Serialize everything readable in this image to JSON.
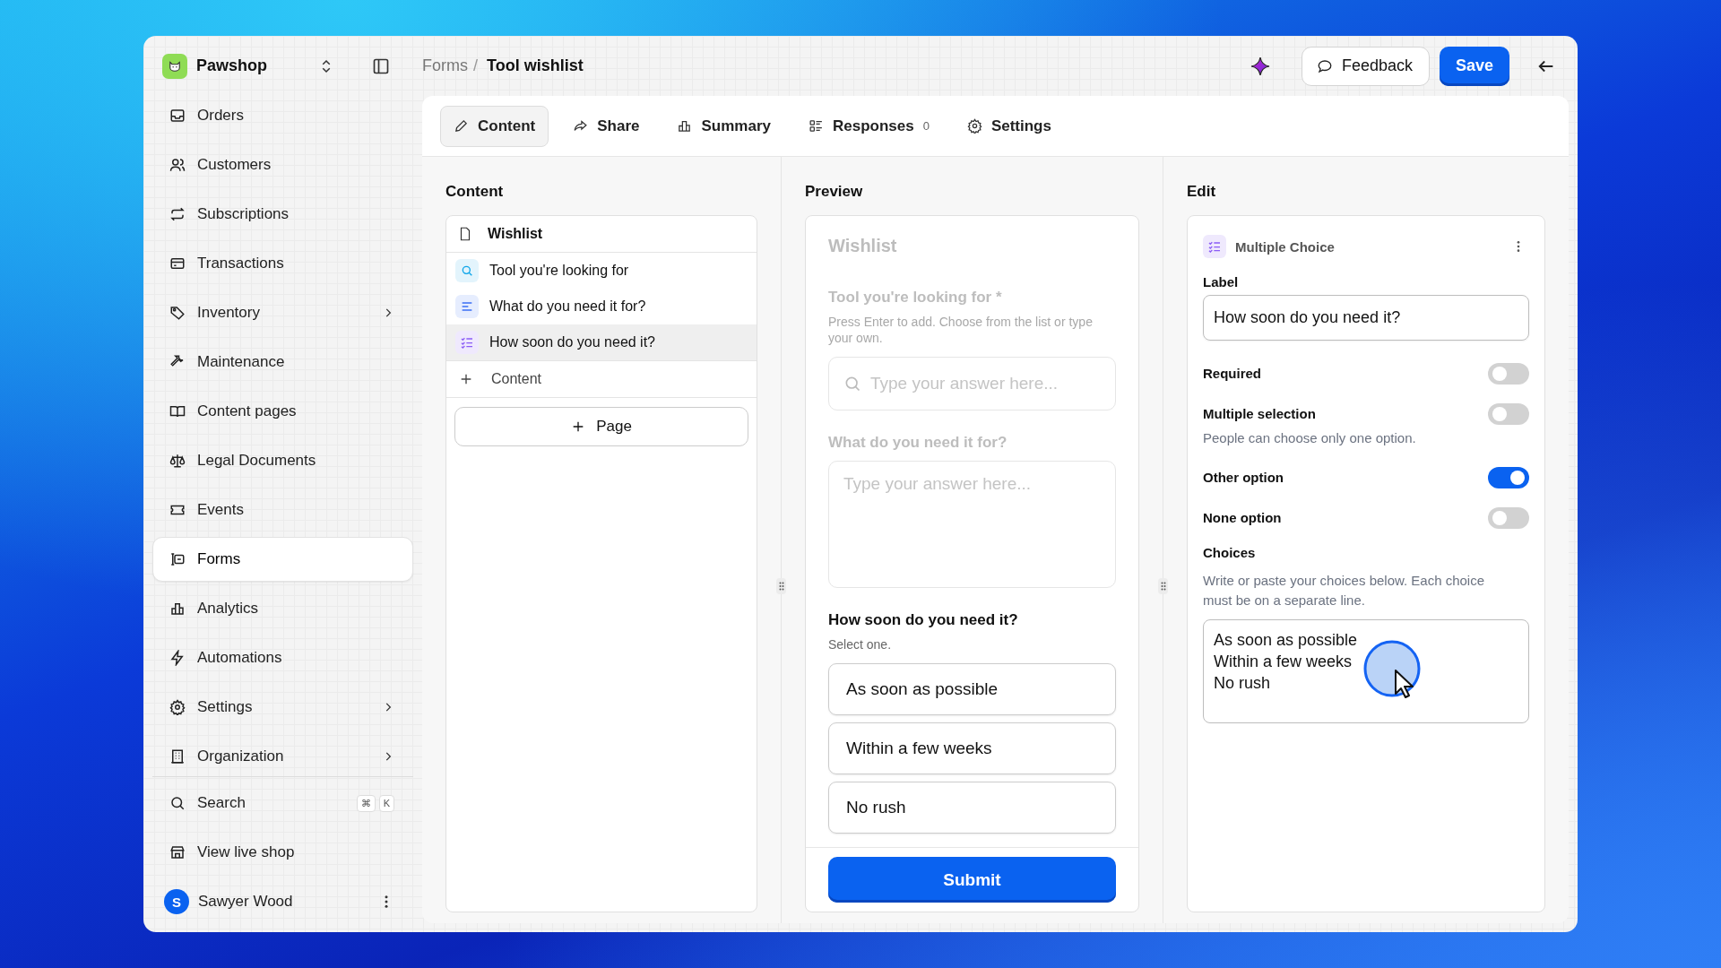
{
  "app": {
    "name": "Pawshop"
  },
  "sidebar": {
    "items": [
      {
        "label": "Orders",
        "selected": false,
        "submenu": false
      },
      {
        "label": "Customers",
        "selected": false,
        "submenu": false
      },
      {
        "label": "Subscriptions",
        "selected": false,
        "submenu": false
      },
      {
        "label": "Transactions",
        "selected": false,
        "submenu": false
      },
      {
        "label": "Inventory",
        "selected": false,
        "submenu": true
      },
      {
        "label": "Maintenance",
        "selected": false,
        "submenu": false
      },
      {
        "label": "Content pages",
        "selected": false,
        "submenu": false
      },
      {
        "label": "Legal Documents",
        "selected": false,
        "submenu": false
      },
      {
        "label": "Events",
        "selected": false,
        "submenu": false
      },
      {
        "label": "Forms",
        "selected": true,
        "submenu": false
      },
      {
        "label": "Analytics",
        "selected": false,
        "submenu": false
      },
      {
        "label": "Automations",
        "selected": false,
        "submenu": false
      },
      {
        "label": "Settings",
        "selected": false,
        "submenu": true
      },
      {
        "label": "Organization",
        "selected": false,
        "submenu": true
      }
    ],
    "footer_items": [
      {
        "label": "Search",
        "shortcut": [
          "⌘",
          "K"
        ]
      },
      {
        "label": "View live shop"
      }
    ],
    "user": {
      "initial": "S",
      "name": "Sawyer Wood"
    }
  },
  "breadcrumb": {
    "parent": "Forms",
    "separator": "/",
    "current": "Tool wishlist"
  },
  "actions": {
    "feedback": "Feedback",
    "save": "Save"
  },
  "tabs": [
    {
      "label": "Content",
      "selected": true
    },
    {
      "label": "Share",
      "selected": false
    },
    {
      "label": "Summary",
      "selected": false
    },
    {
      "label": "Responses",
      "selected": false,
      "count": "0"
    },
    {
      "label": "Settings",
      "selected": false
    }
  ],
  "content_panel": {
    "title": "Content",
    "page": "Wishlist",
    "items": [
      {
        "label": "Tool you're looking for",
        "selected": false,
        "kind": "search"
      },
      {
        "label": "What do you need it for?",
        "selected": false,
        "kind": "text"
      },
      {
        "label": "How soon do you need it?",
        "selected": true,
        "kind": "choice"
      }
    ],
    "add_content": "Content",
    "add_page": "Page"
  },
  "preview": {
    "title": "Preview",
    "form_title": "Wishlist",
    "fields": [
      {
        "kind": "search",
        "dimmed": true,
        "label": "Tool you're looking for *",
        "hint": "Press Enter to add. Choose from the list or type your own.",
        "placeholder": "Type your answer here..."
      },
      {
        "kind": "textarea",
        "dimmed": true,
        "label": "What do you need it for?",
        "placeholder": "Type your answer here..."
      },
      {
        "kind": "choice",
        "dimmed": false,
        "label": "How soon do you need it?",
        "hint": "Select one.",
        "options": [
          "As soon as possible",
          "Within a few weeks",
          "No rush"
        ]
      }
    ],
    "submit": "Submit"
  },
  "edit": {
    "title": "Edit",
    "block_type": "Multiple Choice",
    "label_caption": "Label",
    "label_value": "How soon do you need it?",
    "toggles": [
      {
        "label": "Required",
        "on": false
      },
      {
        "label": "Multiple selection",
        "on": false,
        "hint": "People can choose only one option."
      },
      {
        "label": "Other option",
        "on": true
      },
      {
        "label": "None option",
        "on": false
      }
    ],
    "choices": {
      "label": "Choices",
      "hint": "Write or paste your choices below. Each choice must be on a separate line.",
      "lines": [
        "As soon as possible",
        "Within a few weeks",
        "No rush"
      ]
    }
  }
}
